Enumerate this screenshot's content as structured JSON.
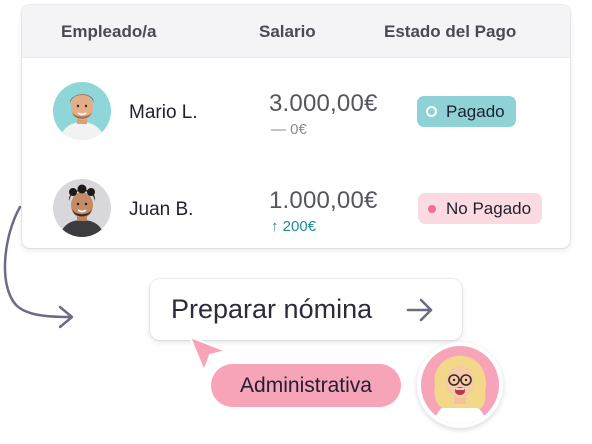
{
  "table": {
    "headers": {
      "employee": "Empleado/a",
      "salary": "Salario",
      "status": "Estado del Pago"
    },
    "rows": [
      {
        "name": "Mario L.",
        "amount": "3.000,00€",
        "delta": "— 0€",
        "status": "Pagado"
      },
      {
        "name": "Juan B.",
        "amount": "1.000,00€",
        "delta": "↑ 200€",
        "status": "No Pagado"
      }
    ]
  },
  "action": {
    "label": "Preparar nómina"
  },
  "role": {
    "label": "Administrativa"
  },
  "colors": {
    "paid": "#8ed2d8",
    "unpaid": "#fbdbe1",
    "accent_pink": "#f7a4b8",
    "positive": "#1e8c8c"
  },
  "icons": [
    "arrow-right-icon",
    "curved-arrow-icon",
    "cursor-pointer-icon",
    "status-dot-icon"
  ]
}
